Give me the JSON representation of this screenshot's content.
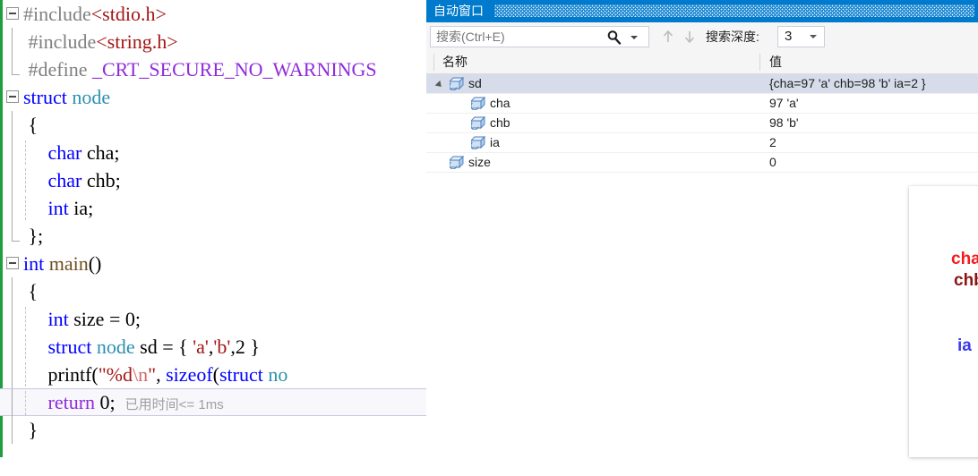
{
  "editor": {
    "lines": [
      {
        "fold": "open",
        "indent": false,
        "tokens": [
          {
            "t": "#include",
            "c": "pre"
          },
          {
            "t": "<stdio.h>",
            "c": "str"
          }
        ]
      },
      {
        "fold": "bar",
        "indent": false,
        "tokens": [
          {
            "t": " #include",
            "c": "pre"
          },
          {
            "t": "<string.h>",
            "c": "str"
          }
        ]
      },
      {
        "fold": "barend",
        "indent": false,
        "tokens": [
          {
            "t": " #define ",
            "c": "pre"
          },
          {
            "t": "_CRT_SECURE_NO_WARNINGS",
            "c": "macro"
          }
        ]
      },
      {
        "fold": "open",
        "indent": false,
        "tokens": [
          {
            "t": "struct ",
            "c": "kw"
          },
          {
            "t": "node",
            "c": "type"
          }
        ]
      },
      {
        "fold": "bar",
        "indent": false,
        "tokens": [
          {
            "t": " {",
            "c": "plain"
          }
        ]
      },
      {
        "fold": "bar",
        "indent": true,
        "tokens": [
          {
            "t": "     ",
            "c": "plain"
          },
          {
            "t": "char",
            "c": "kw"
          },
          {
            "t": " cha;",
            "c": "plain"
          }
        ]
      },
      {
        "fold": "bar",
        "indent": true,
        "tokens": [
          {
            "t": "     ",
            "c": "plain"
          },
          {
            "t": "char",
            "c": "kw"
          },
          {
            "t": " chb;",
            "c": "plain"
          }
        ]
      },
      {
        "fold": "bar",
        "indent": true,
        "tokens": [
          {
            "t": "     ",
            "c": "plain"
          },
          {
            "t": "int",
            "c": "kw"
          },
          {
            "t": " ia;",
            "c": "plain"
          }
        ]
      },
      {
        "fold": "barend",
        "indent": false,
        "tokens": [
          {
            "t": " };",
            "c": "plain"
          }
        ]
      },
      {
        "fold": "open",
        "indent": false,
        "tokens": [
          {
            "t": "int ",
            "c": "kw"
          },
          {
            "t": "main",
            "c": "func"
          },
          {
            "t": "()",
            "c": "plain"
          }
        ]
      },
      {
        "fold": "bar",
        "indent": false,
        "tokens": [
          {
            "t": " {",
            "c": "plain"
          }
        ]
      },
      {
        "fold": "bar",
        "indent": true,
        "tokens": [
          {
            "t": "     ",
            "c": "plain"
          },
          {
            "t": "int",
            "c": "kw"
          },
          {
            "t": " size = 0;",
            "c": "plain"
          }
        ]
      },
      {
        "fold": "bar",
        "indent": true,
        "tokens": [
          {
            "t": "     ",
            "c": "plain"
          },
          {
            "t": "struct ",
            "c": "kw"
          },
          {
            "t": "node",
            "c": "type"
          },
          {
            "t": " sd = { ",
            "c": "plain"
          },
          {
            "t": "'a'",
            "c": "str"
          },
          {
            "t": ",",
            "c": "plain"
          },
          {
            "t": "'b'",
            "c": "str"
          },
          {
            "t": ",2 }",
            "c": "plain"
          }
        ]
      },
      {
        "fold": "bar",
        "indent": true,
        "tokens": [
          {
            "t": "     printf(",
            "c": "plain"
          },
          {
            "t": "\"%d",
            "c": "str"
          },
          {
            "t": "\\n",
            "c": "esc"
          },
          {
            "t": "\"",
            "c": "str"
          },
          {
            "t": ", ",
            "c": "plain"
          },
          {
            "t": "sizeof",
            "c": "kw"
          },
          {
            "t": "(",
            "c": "plain"
          },
          {
            "t": "struct ",
            "c": "kw"
          },
          {
            "t": "no",
            "c": "type"
          }
        ]
      },
      {
        "fold": "bar",
        "indent": true,
        "current": true,
        "tokens": [
          {
            "t": "     ",
            "c": "plain"
          },
          {
            "t": "return",
            "c": "ret"
          },
          {
            "t": " 0;  ",
            "c": "plain"
          },
          {
            "t": "已用时间",
            "c": "dt"
          },
          {
            "t": "<= 1ms",
            "c": "dtms"
          }
        ]
      },
      {
        "fold": "bar",
        "indent": false,
        "tokens": [
          {
            "t": " }",
            "c": "plain"
          }
        ]
      }
    ]
  },
  "autos": {
    "title": "自动窗口",
    "toolbar": {
      "search_placeholder": "搜索(Ctrl+E)",
      "search_icon": "magnifier-icon",
      "search_dropdown_icon": "chevron-down-icon",
      "prev_icon": "arrow-up-icon",
      "next_icon": "arrow-down-icon",
      "depth_label": "搜索深度:",
      "depth_value": "3",
      "depth_dropdown_icon": "chevron-down-icon"
    },
    "columns": {
      "name": "名称",
      "value": "值"
    },
    "rows": [
      {
        "name": "sd",
        "value": "{cha=97 'a' chb=98 'b' ia=2 }",
        "indent": 0,
        "expanded": true,
        "selected": true,
        "icon": "variable-box-icon"
      },
      {
        "name": "cha",
        "value": "97 'a'",
        "indent": 1,
        "expanded": false,
        "selected": false,
        "icon": "variable-box-icon"
      },
      {
        "name": "chb",
        "value": "98 'b'",
        "indent": 1,
        "expanded": false,
        "selected": false,
        "icon": "variable-box-icon"
      },
      {
        "name": "ia",
        "value": "2",
        "indent": 1,
        "expanded": false,
        "selected": false,
        "icon": "variable-box-icon"
      },
      {
        "name": "size",
        "value": "0",
        "indent": 0,
        "expanded": false,
        "selected": false,
        "icon": "variable-box-icon"
      }
    ]
  },
  "diagram": {
    "labels": [
      {
        "text": "char",
        "color": "#f21d1d"
      },
      {
        "text": "chb",
        "color": "#8d1414"
      },
      {
        "text": "ia",
        "color": "#3a3af0"
      }
    ],
    "cell_count": 10,
    "highlights": [
      {
        "name": "cha-byte",
        "color": "#e02020",
        "bytes": 1
      },
      {
        "name": "chb-byte",
        "color": "#8d1414",
        "bytes": 1
      },
      {
        "name": "ia-four-byte",
        "color": "#2b2bc8",
        "bytes": 4
      }
    ]
  },
  "colors": {
    "titlebar": "#007acc",
    "selection": "#d6dcea",
    "chrome": "#f5f5f5",
    "grid_line": "#cfcfcf"
  }
}
